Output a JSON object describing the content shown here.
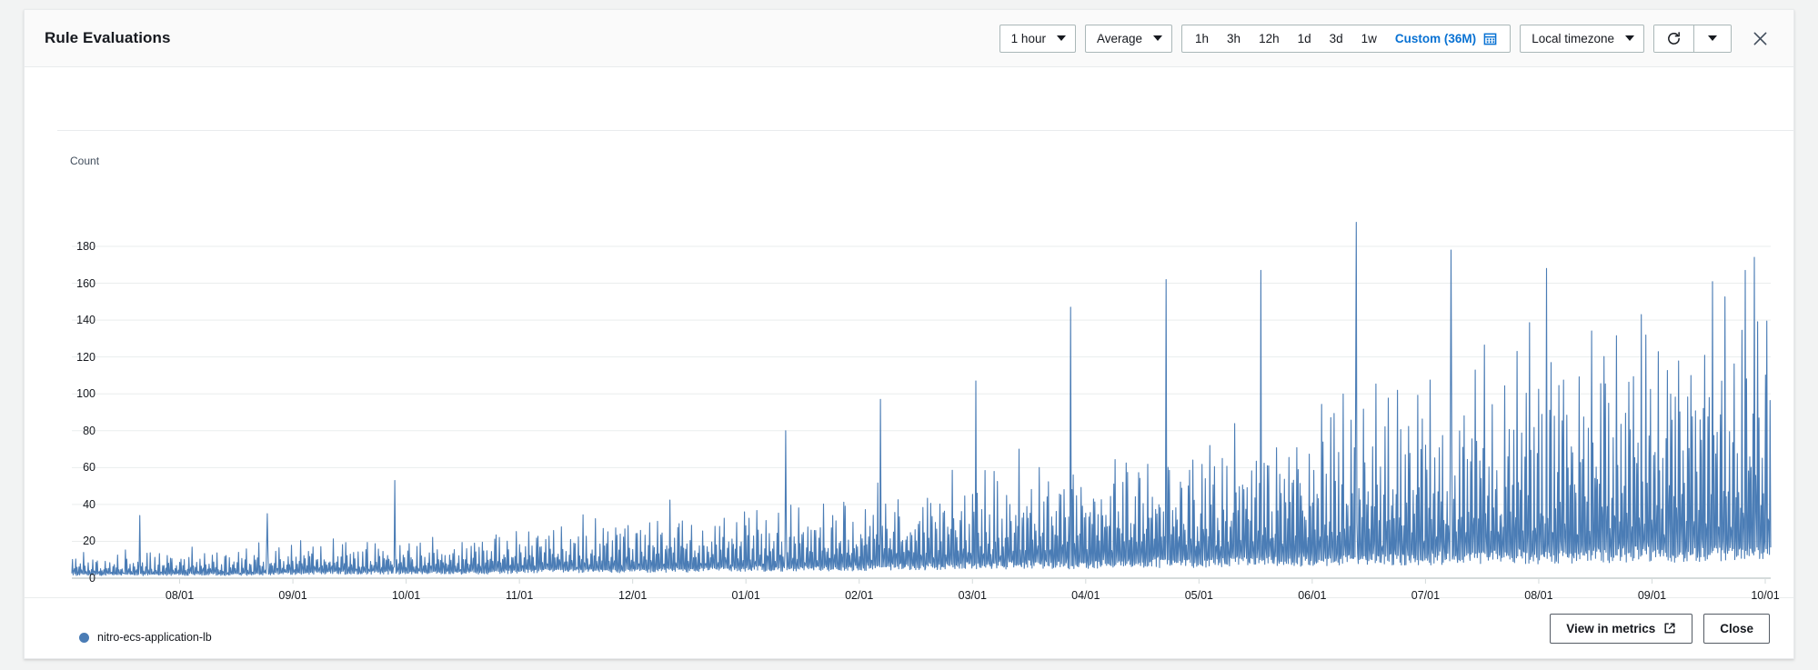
{
  "header": {
    "title": "Rule Evaluations",
    "period_select": {
      "value": "1 hour",
      "icon": "chevron-down-icon"
    },
    "statistic_select": {
      "value": "Average",
      "icon": "chevron-down-icon"
    },
    "range_items": [
      "1h",
      "3h",
      "12h",
      "1d",
      "3d",
      "1w"
    ],
    "custom_range": {
      "label": "Custom (36M)",
      "icon": "calendar-icon"
    },
    "timezone_select": {
      "value": "Local timezone",
      "icon": "chevron-down-icon"
    },
    "refresh": {
      "icon": "refresh-icon"
    },
    "refresh_dropdown": {
      "icon": "chevron-down-icon"
    },
    "close": {
      "icon": "close-icon"
    },
    "accent_color": "#0972d3"
  },
  "footer": {
    "view_in_metrics": "View in metrics",
    "view_in_metrics_icon": "external-link-icon",
    "close": "Close"
  },
  "legend": [
    {
      "label": "nitro-ecs-application-lb",
      "color": "#4a7cb5"
    }
  ],
  "chart_data": {
    "type": "line",
    "title": "Rule Evaluations",
    "xlabel": "",
    "ylabel": "Count",
    "axis_name": "Count",
    "grid": true,
    "legend_position": "bottom-left",
    "line_color": "#4a7cb5",
    "ylim": [
      0,
      193
    ],
    "yticks": [
      0,
      20,
      40,
      60,
      80,
      100,
      120,
      140,
      160,
      180
    ],
    "xticks": [
      "08/01",
      "09/01",
      "10/01",
      "11/01",
      "12/01",
      "01/01",
      "02/01",
      "03/01",
      "04/01",
      "05/01",
      "06/01",
      "07/01",
      "08/01",
      "09/01",
      "10/01"
    ],
    "series": [
      {
        "name": "nitro-ecs-application-lb",
        "description": "Hourly average rule evaluation count over 36 months; strong daily cycle with a rising long-term trend from roughly 10 at the start to roughly 120 at the end; highest single peak about 193 near 08/01 of the final year.",
        "envelope_baseline": [
          2,
          2,
          2,
          2,
          3,
          3,
          3,
          3,
          4,
          4,
          4,
          5,
          5,
          5,
          6,
          6,
          7,
          7,
          8,
          8,
          9,
          9,
          10,
          10,
          11,
          11,
          12,
          12,
          13,
          13
        ],
        "envelope_peak": [
          14,
          15,
          16,
          18,
          20,
          22,
          24,
          28,
          30,
          33,
          36,
          38,
          42,
          45,
          50,
          56,
          62,
          68,
          74,
          80,
          88,
          95,
          104,
          112,
          122,
          132,
          143,
          152,
          164,
          172
        ],
        "notable_peaks": [
          {
            "x": "08/01 yr1",
            "y": 34
          },
          {
            "x": "10/15 yr1",
            "y": 35
          },
          {
            "x": "12/10 yr1",
            "y": 53
          },
          {
            "x": "02/10 yr2",
            "y": 80
          },
          {
            "x": "03/20 yr2",
            "y": 97
          },
          {
            "x": "05/05 yr2",
            "y": 107
          },
          {
            "x": "05/20 yr2",
            "y": 147
          },
          {
            "x": "06/25 yr2",
            "y": 162
          },
          {
            "x": "07/05 yr2",
            "y": 167
          },
          {
            "x": "08/01 yr2",
            "y": 193
          },
          {
            "x": "09/01 yr2",
            "y": 178
          },
          {
            "x": "09/20 yr2",
            "y": 168
          },
          {
            "x": "10/01 yr2",
            "y": 143
          }
        ]
      }
    ]
  }
}
